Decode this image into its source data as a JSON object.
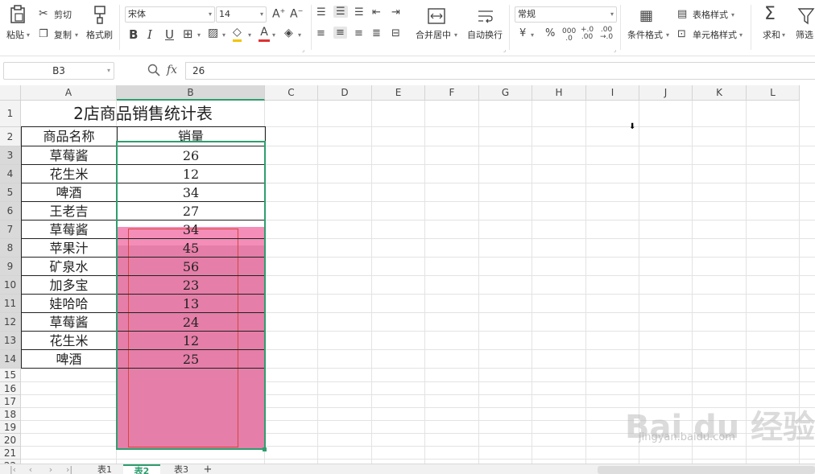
{
  "ribbon": {
    "paste": "粘贴",
    "cut": "剪切",
    "copy": "复制",
    "format_painter": "格式刷",
    "font_name": "宋体",
    "font_size": "14",
    "merge_center": "合并居中",
    "wrap_text": "自动换行",
    "number_format": "常规",
    "conditional_format": "条件格式",
    "table_style": "表格样式",
    "cell_style": "单元格样式",
    "sum": "求和",
    "filter": "筛选"
  },
  "formula_bar": {
    "cell_ref": "B3",
    "fx": "fx",
    "value": "26"
  },
  "columns": [
    "A",
    "B",
    "C",
    "D",
    "E",
    "F",
    "G",
    "H",
    "I",
    "J",
    "K",
    "L"
  ],
  "rows": [
    "1",
    "2",
    "3",
    "4",
    "5",
    "6",
    "7",
    "8",
    "9",
    "10",
    "11",
    "12",
    "13",
    "14",
    "15",
    "16",
    "17",
    "18",
    "19",
    "20",
    "21",
    "22"
  ],
  "sheet": {
    "title": "2店商品销售统计表",
    "header_name": "商品名称",
    "header_sales": "销量",
    "items": [
      {
        "name": "草莓酱",
        "sales": "26"
      },
      {
        "name": "花生米",
        "sales": "12"
      },
      {
        "name": "啤酒",
        "sales": "34"
      },
      {
        "name": "王老吉",
        "sales": "27"
      },
      {
        "name": "草莓酱",
        "sales": "34"
      },
      {
        "name": "苹果汁",
        "sales": "45"
      },
      {
        "name": "矿泉水",
        "sales": "56"
      },
      {
        "name": "加多宝",
        "sales": "23"
      },
      {
        "name": "娃哈哈",
        "sales": "13"
      },
      {
        "name": "草莓酱",
        "sales": "24"
      },
      {
        "name": "花生米",
        "sales": "12"
      },
      {
        "name": "啤酒",
        "sales": "25"
      }
    ]
  },
  "tabs": [
    "表1",
    "表2",
    "表3"
  ],
  "active_tab": "表2",
  "colors": {
    "selection_fill": "#e57ea8",
    "active_cell_fill": "#f48db8",
    "selection_border": "#2f9e6f",
    "active_tab": "#2f9e6f"
  },
  "watermark": {
    "brand": "Bai du 经验",
    "url": "jingyan.baidu.com"
  }
}
